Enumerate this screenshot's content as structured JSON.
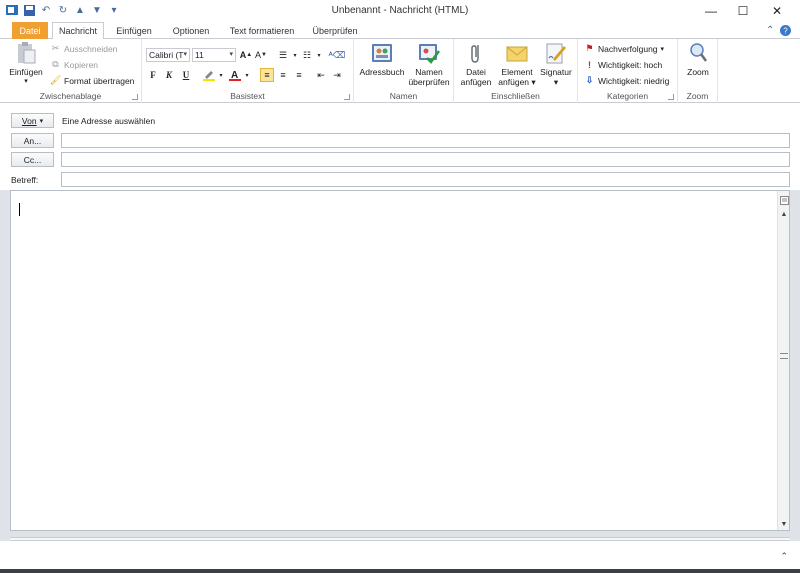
{
  "window": {
    "title": "Unbenannt - Nachricht (HTML)",
    "minimize": "—",
    "maximize": "☐",
    "close": "✕"
  },
  "tabs": [
    {
      "label": "Datei"
    },
    {
      "label": "Nachricht"
    },
    {
      "label": "Einfügen"
    },
    {
      "label": "Optionen"
    },
    {
      "label": "Text formatieren"
    },
    {
      "label": "Überprüfen"
    }
  ],
  "ribbon": {
    "clipboard": {
      "label": "Zwischenablage",
      "paste": "Einfügen",
      "cut": "Ausschneiden",
      "copy": "Kopieren",
      "format_painter": "Format übertragen"
    },
    "basic_text": {
      "label": "Basistext",
      "font": "Calibri (T",
      "size": "11",
      "bold": "F",
      "italic": "K",
      "underline": "U"
    },
    "names": {
      "label": "Namen",
      "address_book": "Adressbuch",
      "check_names_1": "Namen",
      "check_names_2": "überprüfen"
    },
    "include": {
      "label": "Einschließen",
      "attach_file_1": "Datei",
      "attach_file_2": "anfügen",
      "attach_item_1": "Element",
      "attach_item_2": "anfügen",
      "signature": "Signatur"
    },
    "tags": {
      "label": "Kategorien",
      "followup": "Nachverfolgung",
      "high": "Wichtigkeit: hoch",
      "low": "Wichtigkeit: niedrig"
    },
    "zoom": {
      "label": "Zoom",
      "zoom": "Zoom"
    }
  },
  "header": {
    "from_button": "Von",
    "from_value": "Eine Adresse auswählen",
    "to_button": "An...",
    "cc_button": "Cc...",
    "subject_label": "Betreff:"
  }
}
